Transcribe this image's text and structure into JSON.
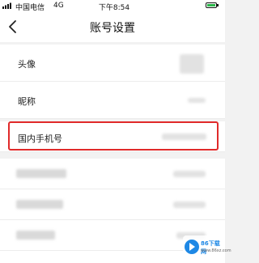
{
  "status_bar": {
    "carrier": "中国电信",
    "network": "4G",
    "time": "下午8:54"
  },
  "nav": {
    "title": "账号设置",
    "back_icon": "chevron-left-icon"
  },
  "settings": {
    "avatar_label": "头像",
    "nickname_label": "昵称",
    "phone_label": "国内手机号"
  },
  "colors": {
    "highlight_border": "#e02a2a",
    "background": "#f2f2f2"
  },
  "watermark": {
    "brand": "86下载网",
    "url": "www.86xz.com"
  }
}
